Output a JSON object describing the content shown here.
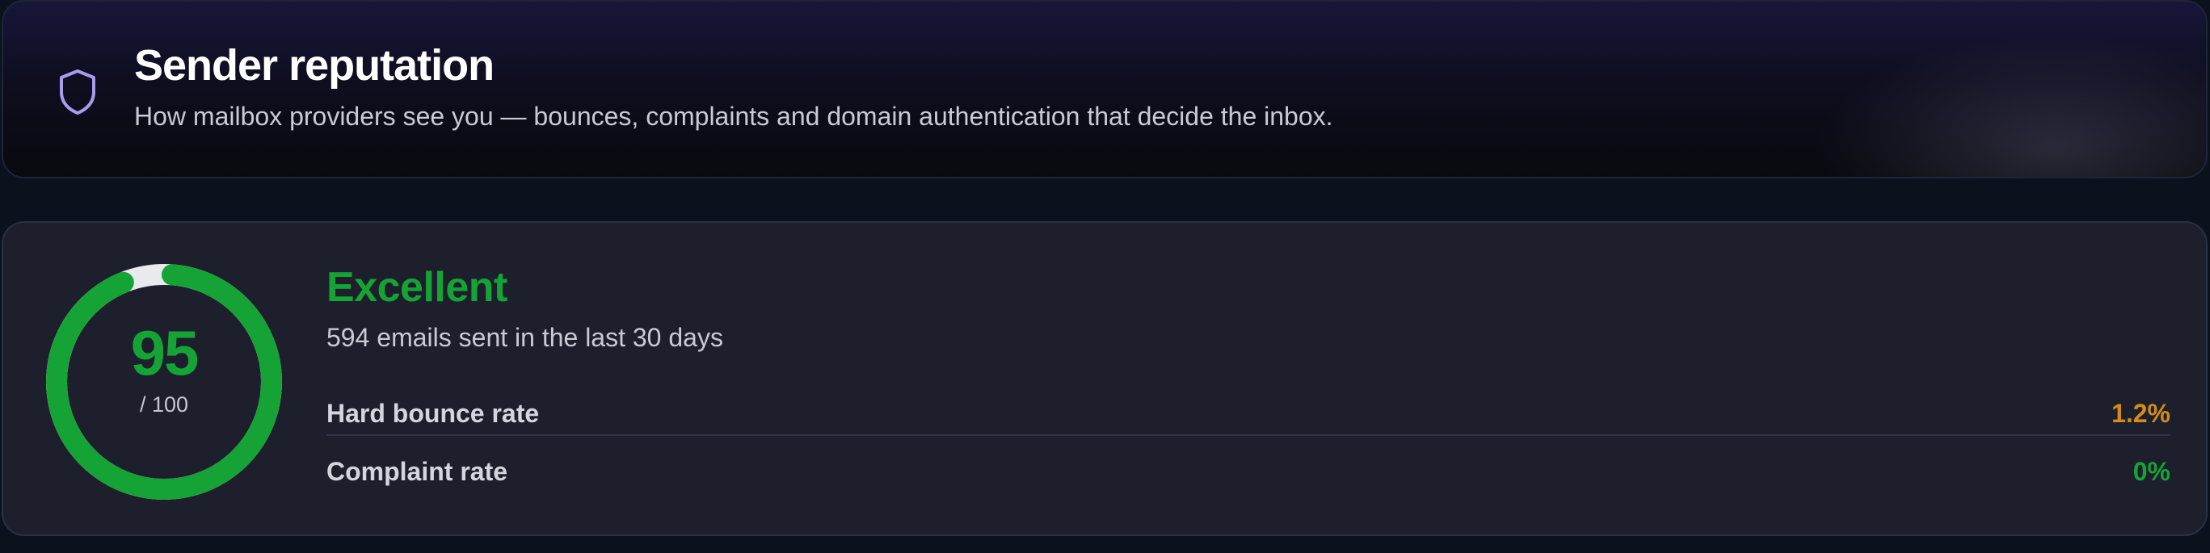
{
  "header": {
    "title": "Sender reputation",
    "subtitle": "How mailbox providers see you — bounces, complaints and domain authentication that decide the inbox.",
    "icon": "shield-icon"
  },
  "reputation": {
    "score": "95",
    "score_max": "/ 100",
    "score_fraction": 0.95,
    "status": "Excellent",
    "emails_sent": "594 emails sent in the last 30 days",
    "metrics": [
      {
        "label": "Hard bounce rate",
        "value": "1.2%",
        "color": "#d48c16"
      },
      {
        "label": "Complaint rate",
        "value": "0%",
        "color": "#16a336"
      }
    ]
  },
  "colors": {
    "good": "#16a336",
    "warning": "#d48c16",
    "gauge_track": "#e9eaee",
    "accent": "#a99cf0"
  }
}
